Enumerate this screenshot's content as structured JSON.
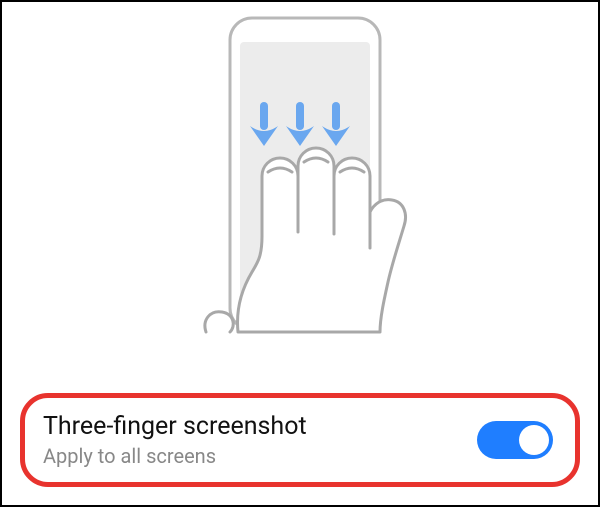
{
  "setting": {
    "title": "Three-finger screenshot",
    "subtitle": "Apply to all screens",
    "enabled": true
  },
  "illustration": {
    "name": "three-finger-swipe-phone-gesture"
  },
  "colors": {
    "accent": "#1f7eff",
    "highlight_border": "#e8332e",
    "text_primary": "#111111",
    "text_secondary": "#888888",
    "arrow": "#6aa7ef"
  }
}
